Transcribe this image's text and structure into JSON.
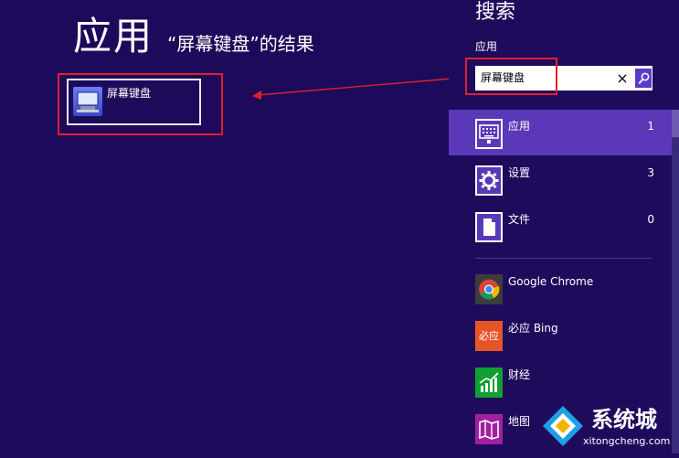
{
  "results": {
    "title": "应用",
    "subtitle": "“屏幕键盘”的结果",
    "items": [
      {
        "label": "屏幕键盘",
        "icon": "on-screen-keyboard-icon"
      }
    ]
  },
  "search_pane": {
    "heading": "搜索",
    "scope_label": "应用",
    "query": "屏幕键盘",
    "clear_icon": "×",
    "search_icon": "magnifier-icon",
    "scopes": [
      {
        "label": "应用",
        "count": "1",
        "icon": "keyboard-grid-icon",
        "selected": true
      },
      {
        "label": "设置",
        "count": "3",
        "icon": "gear-icon",
        "selected": false
      },
      {
        "label": "文件",
        "count": "0",
        "icon": "document-icon",
        "selected": false
      }
    ],
    "apps": [
      {
        "label": "Google Chrome",
        "icon": "chrome-icon",
        "color": "#3c3c3c"
      },
      {
        "label": "必应 Bing",
        "tile_text": "必应",
        "icon": "bing-icon",
        "color": "#e8542a"
      },
      {
        "label": "财经",
        "icon": "finance-chart-icon",
        "color": "#10a030"
      },
      {
        "label": "地图",
        "icon": "maps-icon",
        "color": "#a020a0"
      }
    ]
  },
  "watermark": {
    "text": "系统城",
    "subtext": "xitongcheng.com"
  },
  "colors": {
    "background": "#1e0a5a",
    "selected_row": "#5a38b8",
    "highlight": "#e0202a"
  }
}
